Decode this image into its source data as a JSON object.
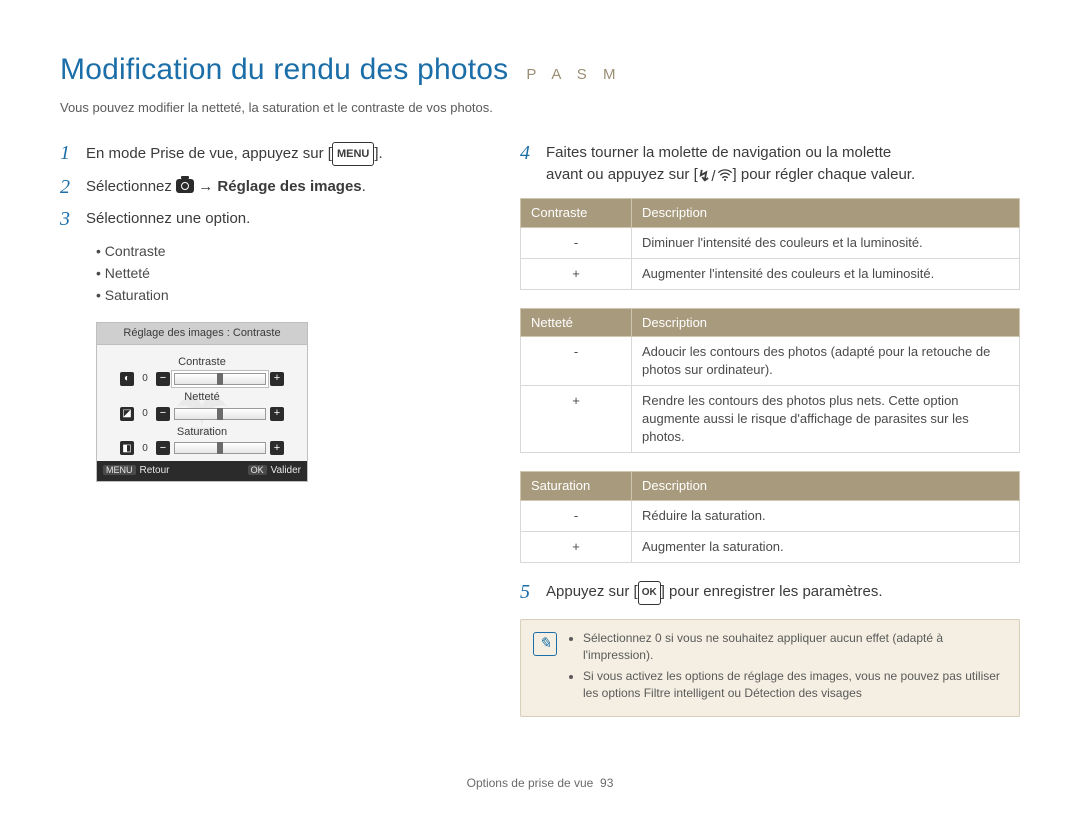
{
  "title": "Modification du rendu des photos",
  "mode_letters": "P A S M",
  "subtitle": "Vous pouvez modifier la netteté, la saturation et le contraste de vos photos.",
  "left": {
    "step1": {
      "num": "1",
      "pre": "En mode Prise de vue, appuyez sur [",
      "badge": "MENU",
      "post": "]."
    },
    "step2": {
      "num": "2",
      "pre": "Sélectionnez ",
      "arrow": " → ",
      "bold_after": "Réglage des images",
      "post": "."
    },
    "step3": {
      "num": "3",
      "text": "Sélectionnez une option."
    },
    "bullets": [
      "Contraste",
      "Netteté",
      "Saturation"
    ],
    "lcd": {
      "header": "Réglage des images : Contraste",
      "rows": [
        {
          "label": "Contraste",
          "icon": "◐",
          "value": "0"
        },
        {
          "label": "Netteté",
          "icon": "◪",
          "value": "0"
        },
        {
          "label": "Saturation",
          "icon": "◧",
          "value": "0"
        }
      ],
      "foot_left_btn": "MENU",
      "foot_left": "Retour",
      "foot_right_btn": "OK",
      "foot_right": "Valider"
    }
  },
  "right": {
    "step4": {
      "num": "4",
      "line1": "Faites tourner la molette de navigation ou la molette",
      "line2_pre": "avant ou appuyez sur [",
      "line2_post": "] pour régler chaque valeur."
    },
    "tables": [
      {
        "head1": "Contraste",
        "head2": "Description",
        "rows": [
          {
            "sign": "-",
            "desc": "Diminuer l'intensité des couleurs et la luminosité."
          },
          {
            "sign": "+",
            "desc": "Augmenter l'intensité des couleurs et la luminosité."
          }
        ]
      },
      {
        "head1": "Netteté",
        "head2": "Description",
        "rows": [
          {
            "sign": "-",
            "desc": "Adoucir les contours des photos (adapté pour la retouche de photos sur ordinateur)."
          },
          {
            "sign": "+",
            "desc": "Rendre les contours des photos plus nets. Cette option augmente aussi le risque d'affichage de parasites sur les photos."
          }
        ]
      },
      {
        "head1": "Saturation",
        "head2": "Description",
        "rows": [
          {
            "sign": "-",
            "desc": "Réduire la saturation."
          },
          {
            "sign": "+",
            "desc": "Augmenter la saturation."
          }
        ]
      }
    ],
    "step5": {
      "num": "5",
      "pre": "Appuyez sur [",
      "ok": "OK",
      "post": "] pour enregistrer les paramètres."
    },
    "note": [
      "Sélectionnez 0 si vous ne souhaitez appliquer aucun effet (adapté à l'impression).",
      "Si vous activez les options de réglage des images, vous ne pouvez pas utiliser les options Filtre intelligent ou Détection des visages"
    ]
  },
  "footer": {
    "section": "Options de prise de vue",
    "page": "93"
  }
}
